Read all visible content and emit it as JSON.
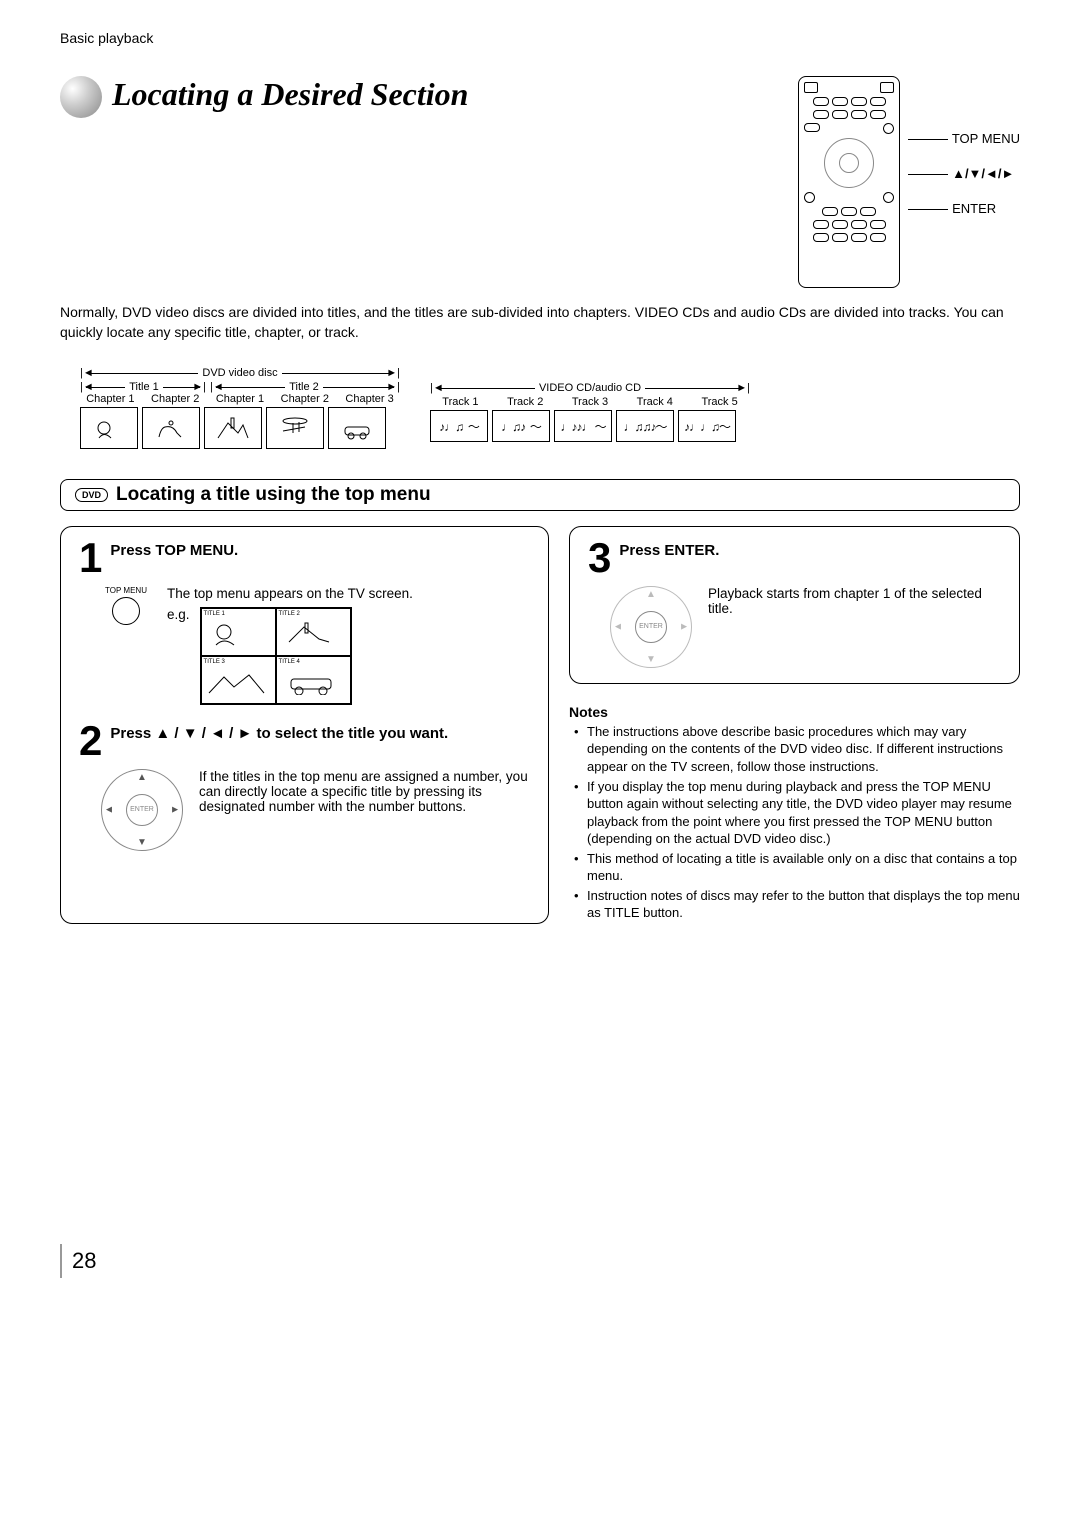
{
  "header": "Basic playback",
  "page_title": "Locating a Desired Section",
  "remote_labels": {
    "top_menu": "TOP MENU",
    "arrows": "▲/▼/◄/►",
    "enter": "ENTER"
  },
  "intro": "Normally, DVD video discs are divided into titles, and the titles are sub-divided into chapters. VIDEO CDs and audio CDs are divided into tracks. You can quickly locate any specific title, chapter, or track.",
  "dvd_diagram": {
    "label": "DVD video disc",
    "title1": "Title 1",
    "title2": "Title 2",
    "chapters": [
      "Chapter 1",
      "Chapter 2",
      "Chapter 1",
      "Chapter 2",
      "Chapter 3"
    ]
  },
  "cd_diagram": {
    "label": "VIDEO CD/audio CD",
    "tracks": [
      "Track 1",
      "Track 2",
      "Track 3",
      "Track 4",
      "Track 5"
    ]
  },
  "section_title": "Locating a title using the top menu",
  "dvd_badge": "DVD",
  "steps": {
    "s1": {
      "num": "1",
      "title": "Press TOP MENU.",
      "btn_label": "TOP MENU",
      "line1": "The top menu appears on the TV screen.",
      "eg_label": "e.g.",
      "titles": [
        "TITLE 1",
        "TITLE 2",
        "TITLE 3",
        "TITLE 4"
      ]
    },
    "s2": {
      "num": "2",
      "title": "Press ▲ / ▼ / ◄ / ► to select the title you want.",
      "body": "If the titles in the top menu are assigned a number, you can directly locate a specific title by pressing its designated number with the number buttons."
    },
    "s3": {
      "num": "3",
      "title": "Press ENTER.",
      "body": "Playback starts from chapter 1 of the selected title."
    }
  },
  "notes_title": "Notes",
  "notes": [
    "The instructions above describe basic procedures which may vary depending on the contents of the DVD video disc. If different instructions appear on the TV screen, follow those instructions.",
    "If you display the top menu during playback and press the TOP MENU button again without selecting any title, the DVD video player may resume playback from the point where you first pressed the TOP MENU button (depending on the actual DVD video disc.)",
    "This method of locating a title is available only on a disc that contains a top menu.",
    "Instruction notes of discs may refer to the button that displays the top menu as TITLE button."
  ],
  "page_number": "28"
}
